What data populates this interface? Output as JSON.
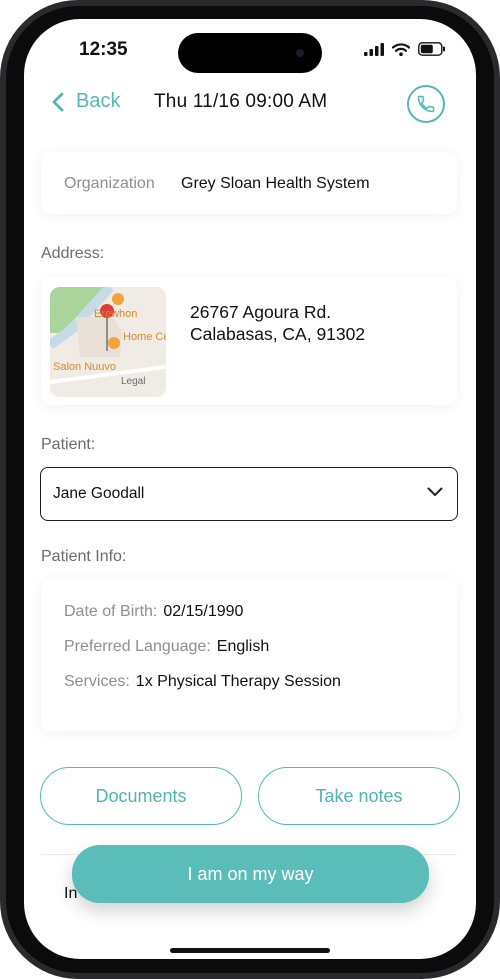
{
  "status_bar": {
    "time": "12:35"
  },
  "nav": {
    "back_label": "Back",
    "title": "Thu 11/16 09:00 AM"
  },
  "organization": {
    "label": "Organization",
    "value": "Grey Sloan Health System"
  },
  "address": {
    "section_label": "Address:",
    "line1": "26767 Agoura Rd.",
    "line2": "Calabasas, CA, 91302",
    "map_labels": {
      "place1": "Erewhon",
      "place2": "Home Center",
      "place3": "Salon Nuuvo",
      "legal": "Legal"
    }
  },
  "patient": {
    "section_label": "Patient:",
    "selected": "Jane Goodall"
  },
  "patient_info": {
    "section_label": "Patient Info:",
    "rows": [
      {
        "label": "Date of Birth:",
        "value": "02/15/1990"
      },
      {
        "label": "Preferred Language:",
        "value": "English"
      },
      {
        "label": "Services:",
        "value": "1x Physical Therapy Session"
      }
    ]
  },
  "actions": {
    "documents": "Documents",
    "take_notes": "Take notes",
    "primary": "I am on my way"
  },
  "peek_text": "In",
  "icons": [
    "chevron-left-icon",
    "phone-icon",
    "chevron-down-icon",
    "signal-icon",
    "wifi-icon",
    "battery-icon",
    "map-pin-icon"
  ],
  "colors": {
    "accent": "#52b8b4",
    "primary_button": "#5abdb9"
  }
}
